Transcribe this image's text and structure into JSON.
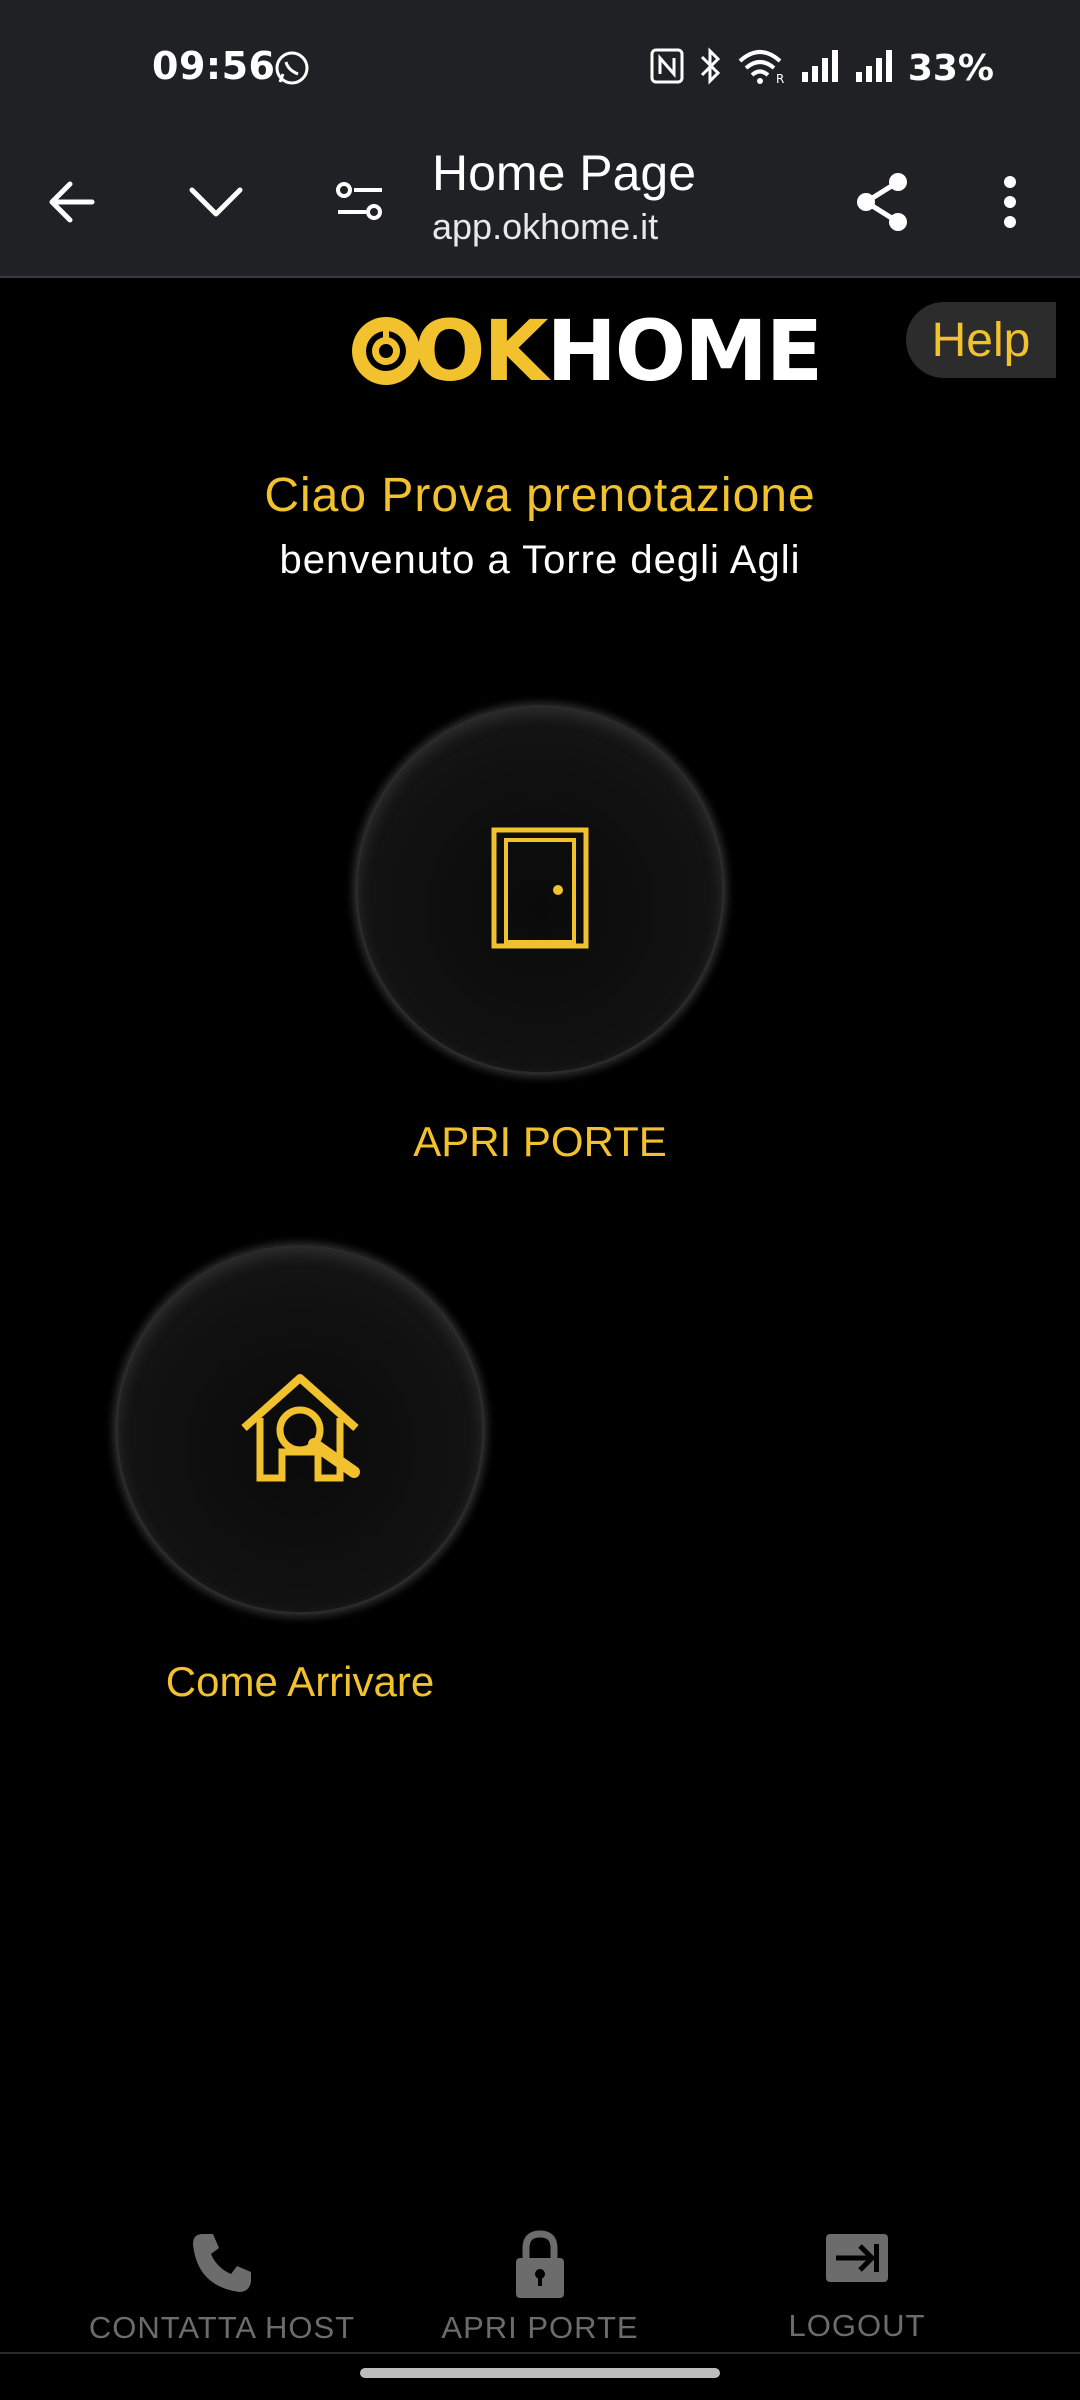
{
  "status_bar": {
    "time": "09:56",
    "battery": "33%",
    "icons": [
      "whatsapp-icon",
      "nfc-icon",
      "bluetooth-icon",
      "wifi-icon",
      "signal-icon",
      "signal-icon"
    ]
  },
  "browser": {
    "title": "Home Page",
    "url": "app.okhome.it",
    "icons": [
      "back-arrow-icon",
      "chevron-down-icon",
      "tune-icon",
      "share-icon",
      "more-vert-icon"
    ]
  },
  "header": {
    "logo_ok": "OK",
    "logo_home": "HOME",
    "help_label": "Help"
  },
  "greeting": {
    "hello": "Ciao Prova prenotazione",
    "welcome": "benvenuto a Torre degli Agli"
  },
  "actions": {
    "open_doors": {
      "label": "APRI PORTE",
      "icon": "door-icon"
    },
    "directions": {
      "label": "Come Arrivare",
      "icon": "house-search-icon"
    }
  },
  "bottom_nav": {
    "items": [
      {
        "label": "CONTATTA HOST",
        "icon": "phone-icon"
      },
      {
        "label": "APRI PORTE",
        "icon": "lock-icon"
      },
      {
        "label": "LOGOUT",
        "icon": "logout-icon"
      }
    ]
  },
  "colors": {
    "accent": "#f2c12e",
    "background": "#000000",
    "toolbar": "#202124",
    "nav_muted": "#6c6c6c"
  }
}
